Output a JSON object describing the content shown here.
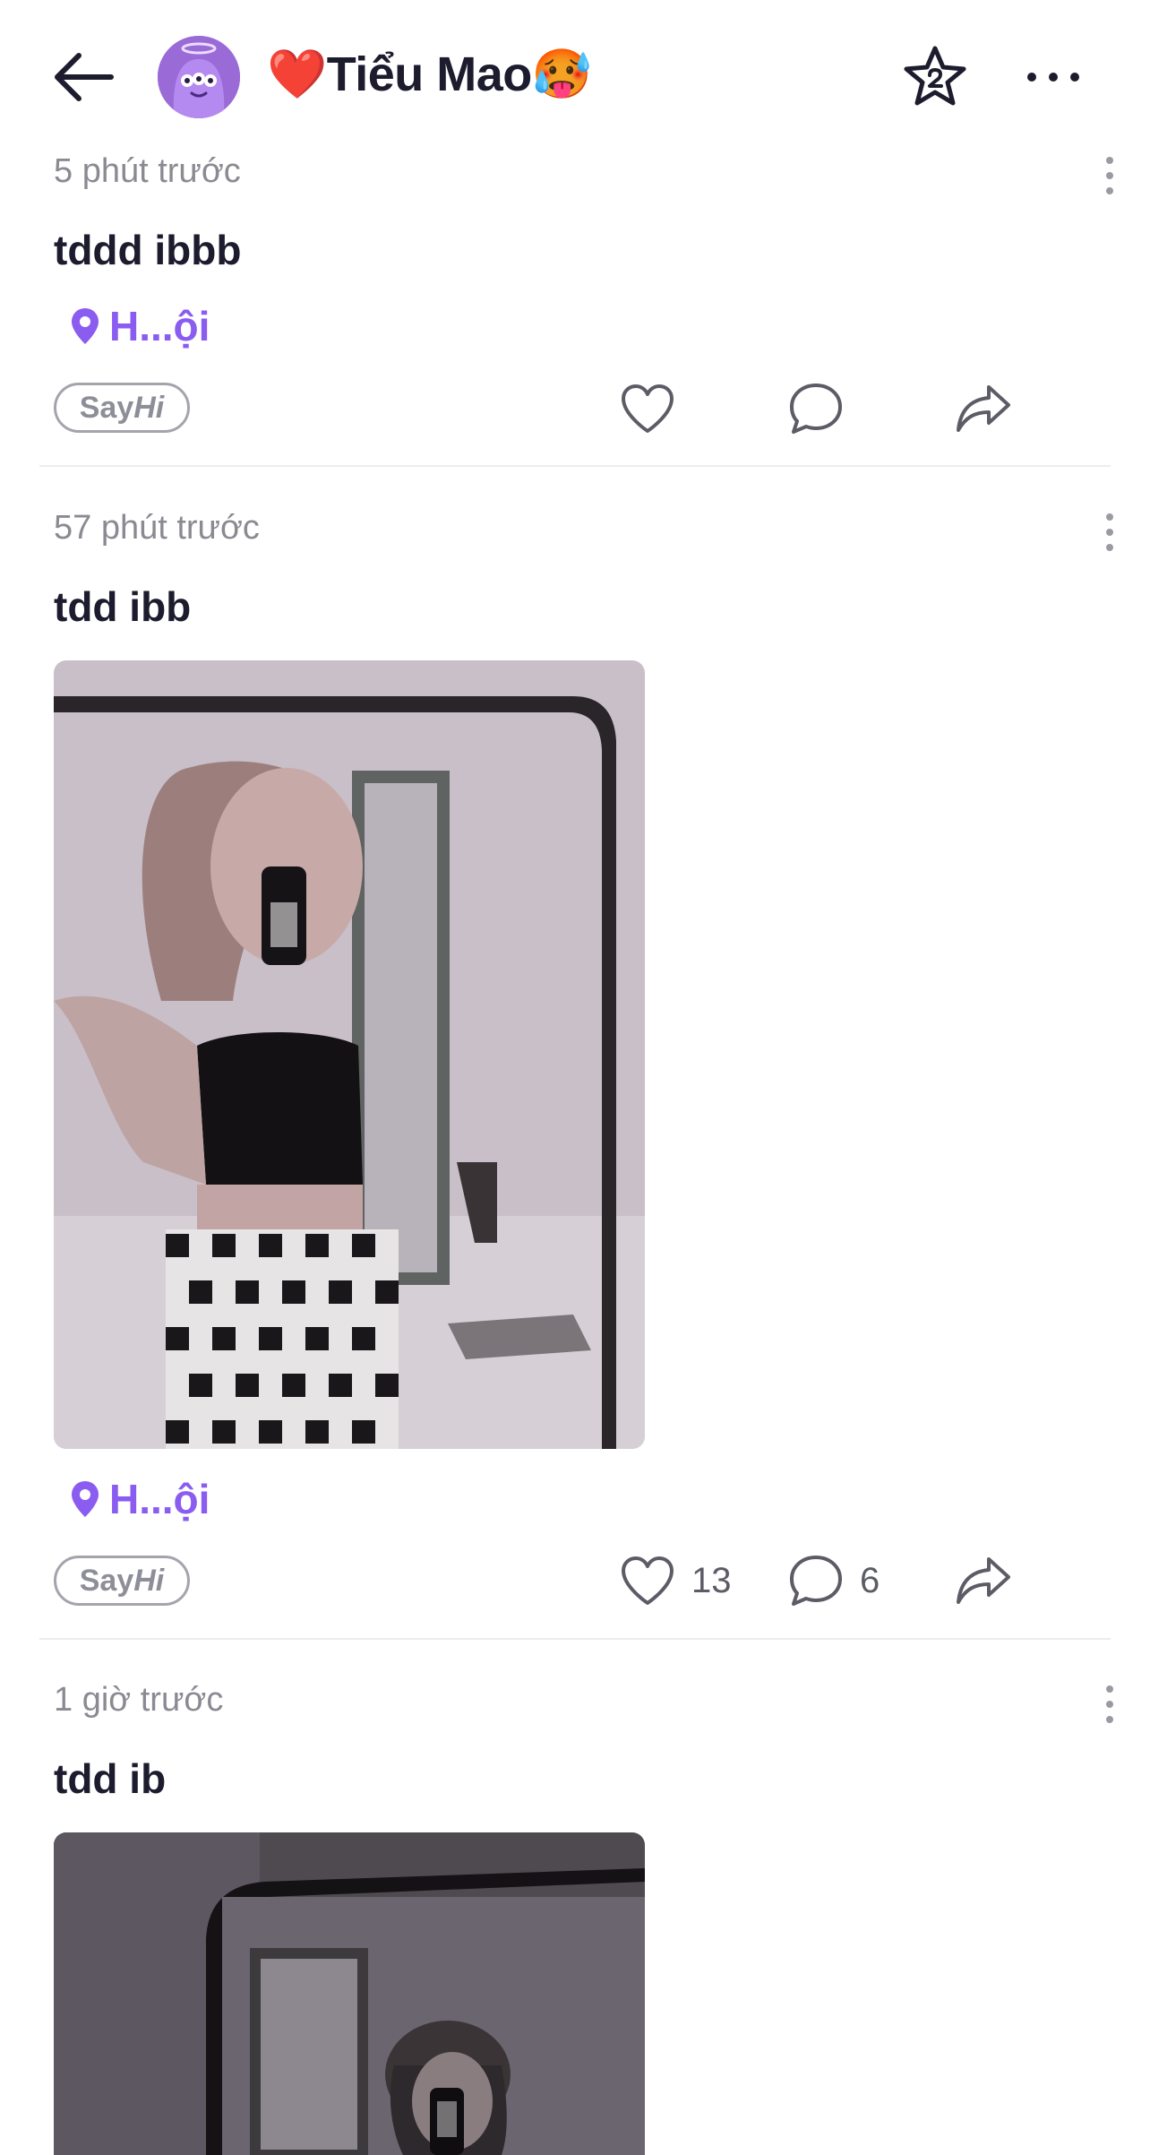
{
  "header": {
    "title": "❤️Tiểu Mao🥵"
  },
  "posts": [
    {
      "time": "5 phút trước",
      "text": "tddd ibbb",
      "location": "H...ội",
      "sayhi": {
        "say": "Say",
        "hi": "Hi"
      },
      "likes": "",
      "comments": ""
    },
    {
      "time": "57 phút trước",
      "text": "tdd ibb",
      "location": "H...ội",
      "sayhi": {
        "say": "Say",
        "hi": "Hi"
      },
      "likes": "13",
      "comments": "6"
    },
    {
      "time": "1 giờ trước",
      "text": "tdd ib"
    }
  ],
  "colors": {
    "accent": "#8a5cf0",
    "text": "#1c1c2e",
    "muted": "#8a8a93"
  },
  "icons": [
    "back-arrow-icon",
    "star-icon",
    "more-icon",
    "kebab-icon",
    "location-pin-icon",
    "heart-icon",
    "comment-icon",
    "share-icon"
  ]
}
